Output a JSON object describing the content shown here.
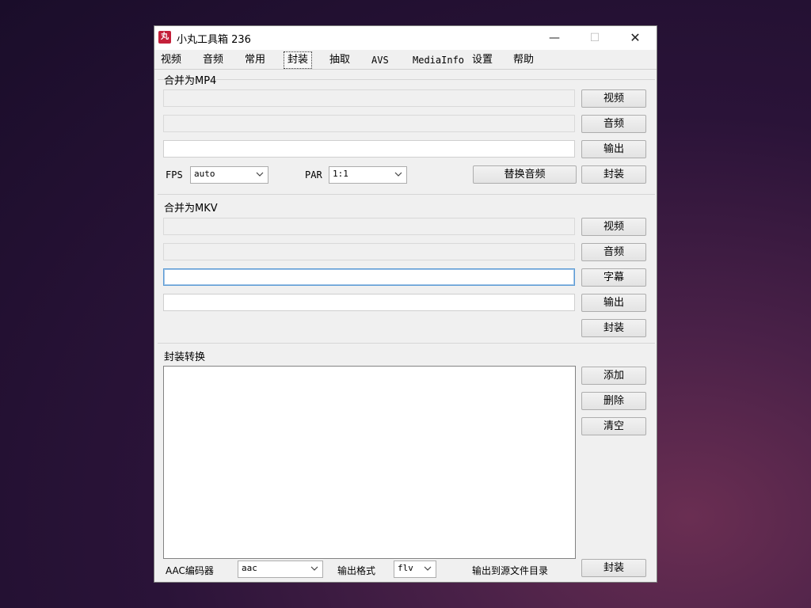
{
  "window": {
    "title": "小丸工具箱 236",
    "icon_glyph": "丸",
    "min_glyph": "—",
    "max_glyph": "☐",
    "close_glyph": "✕"
  },
  "tabs": [
    "视频",
    "音频",
    "常用",
    "封装",
    "抽取",
    "AVS",
    "MediaInfo",
    "设置",
    "帮助"
  ],
  "active_tab": "封装",
  "mp4": {
    "title": "合并为MP4",
    "video_btn": "视频",
    "audio_btn": "音频",
    "output_btn": "输出",
    "mux_btn": "封装",
    "fps_label": "FPS",
    "fps_value": "auto",
    "par_label": "PAR",
    "par_value": "1:1",
    "replace_audio_btn": "替换音频"
  },
  "mkv": {
    "title": "合并为MKV",
    "video_btn": "视频",
    "audio_btn": "音频",
    "subtitle_btn": "字幕",
    "output_btn": "输出",
    "mux_btn": "封装"
  },
  "convert": {
    "title": "封装转换",
    "add_btn": "添加",
    "delete_btn": "删除",
    "clear_btn": "清空",
    "aac_label": "AAC编码器",
    "aac_value": "aac",
    "format_label": "输出格式",
    "format_value": "flv",
    "output_dir_label": "输出到源文件目录",
    "mux_btn": "封装"
  }
}
